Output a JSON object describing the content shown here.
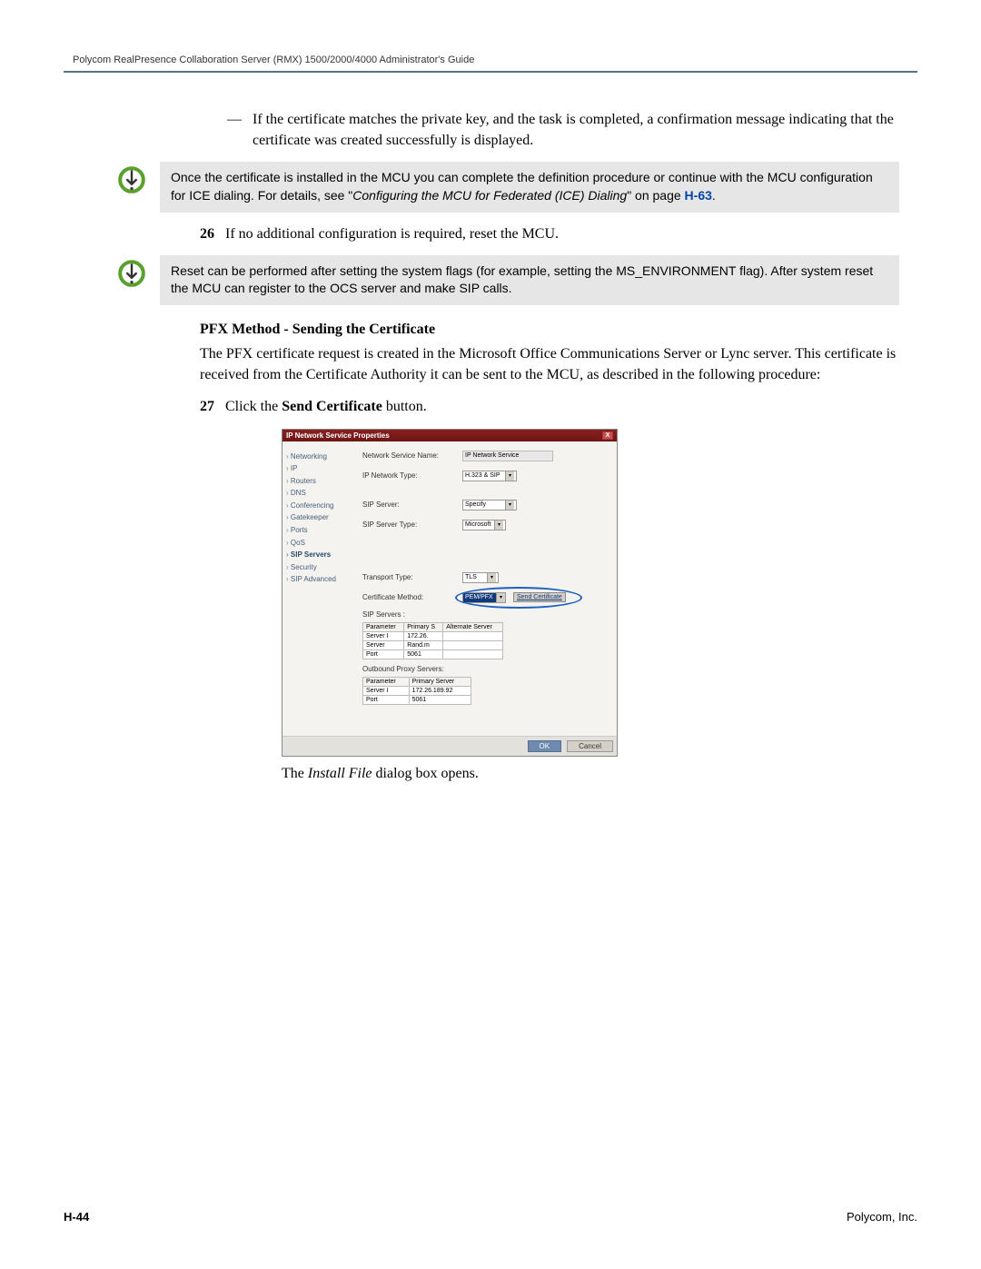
{
  "header": {
    "title": "Polycom RealPresence Collaboration Server (RMX) 1500/2000/4000 Administrator's Guide"
  },
  "content": {
    "dash_text": "If the certificate matches the private key, and the task is completed, a confirmation message indicating that the certificate was created successfully is displayed.",
    "note1_prefix": "Once the certificate is installed in the MCU you can complete the definition procedure or continue with the MCU configuration for ICE dialing. For details, see \"",
    "note1_italic": "Configuring the MCU for Federated (ICE) Dialing",
    "note1_suffix": "\" on page ",
    "note1_link": "H-63",
    "note1_end": ".",
    "step26_num": "26",
    "step26_text": "If no additional configuration is required, reset the MCU.",
    "note2_text": "Reset can be performed after setting the system flags (for example, setting the MS_ENVIRONMENT flag). After system reset the MCU can register to the OCS server and make SIP calls.",
    "section_title": "PFX Method - Sending the Certificate",
    "section_para": "The PFX certificate request is created in the Microsoft Office Communications Server or Lync server. This certificate is received from the Certificate Authority it can be sent to the MCU, as described in the following procedure:",
    "step27_num": "27",
    "step27_text_a": "Click the ",
    "step27_text_b": "Send Certificate",
    "step27_text_c": " button.",
    "result_text_a": "The ",
    "result_text_b": "Install File",
    "result_text_c": " dialog box opens."
  },
  "window": {
    "title": "IP Network Service Properties",
    "tree": [
      "Networking",
      "IP",
      "Routers",
      "DNS",
      "Conferencing",
      "Gatekeeper",
      "Ports",
      "QoS",
      "SIP Servers",
      "Security",
      "SIP Advanced"
    ],
    "tree_selected": "SIP Servers",
    "labels": {
      "svc_name": "Network Service Name:",
      "net_type": "IP Network Type:",
      "sip_server": "SIP Server:",
      "sip_server_type": "SIP Server Type:",
      "transport": "Transport Type:",
      "cert_method": "Certificate Method:",
      "sip_servers_sub": "SIP Servers :",
      "outbound_sub": "Outbound Proxy Servers:"
    },
    "values": {
      "svc_name": "IP Network Service",
      "net_type": "H.323 & SIP",
      "sip_server": "Specify",
      "sip_server_type": "Microsoft",
      "transport": "TLS",
      "cert_method": "PEM/PFX",
      "send_btn": "Send Certificate"
    },
    "table1": {
      "headers": [
        "Parameter",
        "Primary S",
        "Alternate Server"
      ],
      "rows": [
        [
          "Server I",
          "172.26.",
          ""
        ],
        [
          "Server",
          "Rand.m",
          ""
        ],
        [
          "Port",
          "5061",
          ""
        ]
      ]
    },
    "table2": {
      "headers": [
        "Parameter",
        "Primary Server"
      ],
      "rows": [
        [
          "Server I",
          "172.26.189.92"
        ],
        [
          "Port",
          "5061"
        ]
      ]
    },
    "ok": "OK",
    "cancel": "Cancel",
    "close": "X"
  },
  "footer": {
    "page": "H-44",
    "org": "Polycom, Inc."
  }
}
